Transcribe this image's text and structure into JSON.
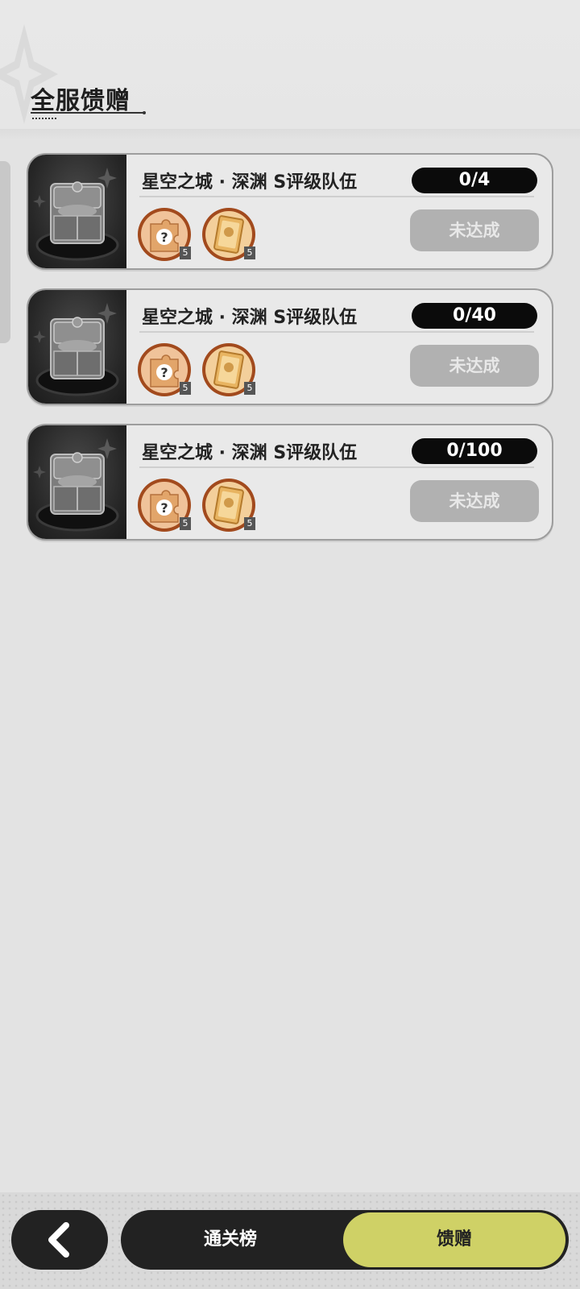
{
  "header": {
    "title": "全服馈赠"
  },
  "rewards": [
    {
      "title": "星空之城 · 深渊 S评级队伍",
      "progress": "0/4",
      "status": "未达成",
      "items": [
        {
          "name": "mystery-puzzle",
          "count": "5"
        },
        {
          "name": "golden-card",
          "count": "5"
        }
      ]
    },
    {
      "title": "星空之城 · 深渊 S评级队伍",
      "progress": "0/40",
      "status": "未达成",
      "items": [
        {
          "name": "mystery-puzzle",
          "count": "5"
        },
        {
          "name": "golden-card",
          "count": "5"
        }
      ]
    },
    {
      "title": "星空之城 · 深渊 S评级队伍",
      "progress": "0/100",
      "status": "未达成",
      "items": [
        {
          "name": "mystery-puzzle",
          "count": "5"
        },
        {
          "name": "golden-card",
          "count": "5"
        }
      ]
    }
  ],
  "bottom_nav": {
    "back_icon": "chevron-left-icon",
    "tabs": [
      {
        "label": "通关榜",
        "active": false
      },
      {
        "label": "馈赠",
        "active": true
      }
    ]
  },
  "colors": {
    "active_tab": "#cfd166",
    "button_disabled": "#b1b1b1",
    "progress_bg": "#0b0b0b"
  }
}
